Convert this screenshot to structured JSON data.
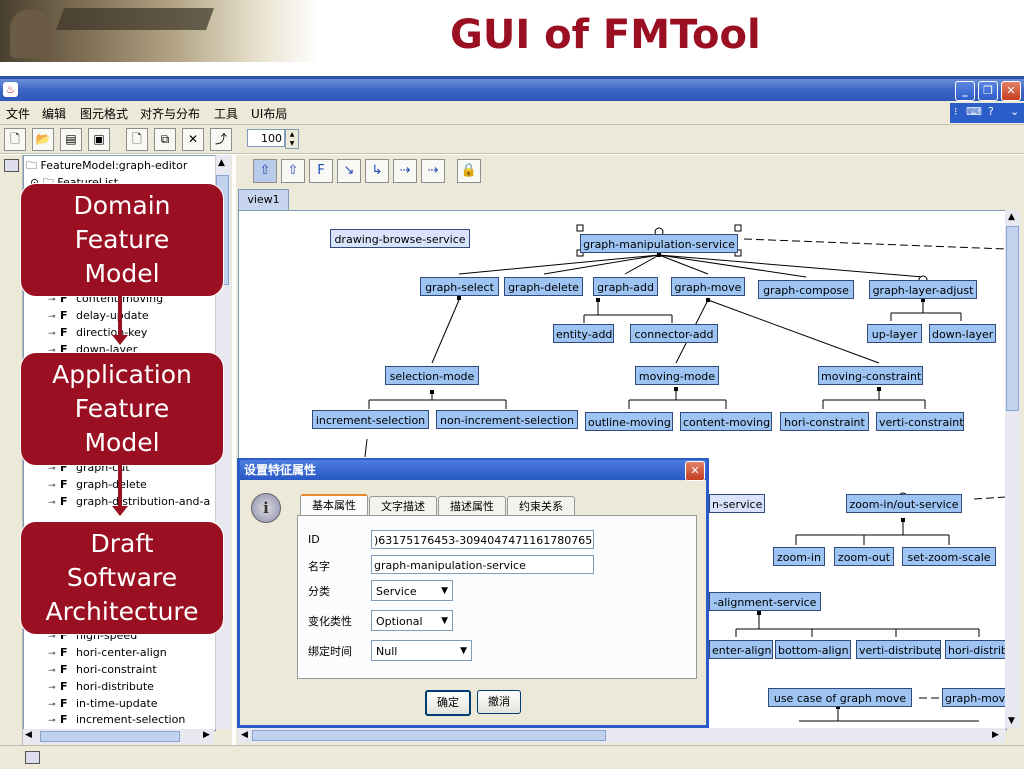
{
  "slide": {
    "title": "GUI of FMTool"
  },
  "menubar": {
    "items": [
      "文件",
      "编辑",
      "图元格式",
      "对齐与分布",
      "工具",
      "UI布局"
    ]
  },
  "toolbar": {
    "zoom": "100"
  },
  "tree": {
    "root": "FeatureModel:graph-editor",
    "folder": "FeatureList",
    "items": [
      "content-moving",
      "delay-update",
      "direction-key",
      "down-layer",
      "graph-cut",
      "graph-delete",
      "graph-distribution-and-a",
      "high-speed",
      "hori-center-align",
      "hori-constraint",
      "hori-distribute",
      "in-time-update",
      "increment-selection"
    ],
    "feature_letter": "F"
  },
  "callouts": {
    "domain": [
      "Domain",
      "Feature",
      "Model"
    ],
    "application": [
      "Application",
      "Feature",
      "Model"
    ],
    "draft": [
      "Draft",
      "Software",
      "Architecture"
    ]
  },
  "canvas": {
    "tab": "view1",
    "nodes": {
      "drawing_browse": "drawing-browse-service",
      "graph_manipulation": "graph-manipulation-service",
      "graph_select": "graph-select",
      "graph_delete": "graph-delete",
      "graph_add": "graph-add",
      "graph_move": "graph-move",
      "graph_compose": "graph-compose",
      "graph_layer_adjust": "graph-layer-adjust",
      "entity_add": "entity-add",
      "connector_add": "connector-add",
      "up_layer": "up-layer",
      "down_layer": "down-layer",
      "selection_mode": "selection-mode",
      "moving_mode": "moving-mode",
      "moving_constraint": "moving-constraint",
      "increment_selection": "increment-selection",
      "non_increment_selection": "non-increment-selection",
      "outline_moving": "outline-moving",
      "content_moving": "content-moving",
      "hori_constraint": "hori-constraint",
      "verti_constraint": "verti-constraint",
      "service_partial": "n-service",
      "zoom_service": "zoom-in/out-service",
      "zoom_in": "zoom-in",
      "zoom_out": "zoom-out",
      "set_zoom_scale": "set-zoom-scale",
      "alignment_service": "-alignment-service",
      "center_align": "enter-align",
      "bottom_align": "bottom-align",
      "verti_distribute": "verti-distribute",
      "hori_distrib": "hori-distrib",
      "use_case": "use case of graph move",
      "graph_mov": "graph-mov"
    }
  },
  "dialog": {
    "title": "设置特征属性",
    "tabs": [
      "基本属性",
      "文字描述",
      "描述属性",
      "约束关系"
    ],
    "fields": {
      "id_label": "ID",
      "id_value": ")63175176453-3094047471161780765",
      "name_label": "名字",
      "name_value": "graph-manipulation-service",
      "category_label": "分类",
      "category_value": "Service",
      "variability_label": "变化类性",
      "variability_value": "Optional",
      "binding_label": "绑定时间",
      "binding_value": "Null"
    },
    "ok": "确定",
    "cancel": "撤消"
  },
  "colors": {
    "title_red": "#9b0f22",
    "node_blue": "#9dc4f2",
    "xp_blue": "#2c5cc9"
  }
}
